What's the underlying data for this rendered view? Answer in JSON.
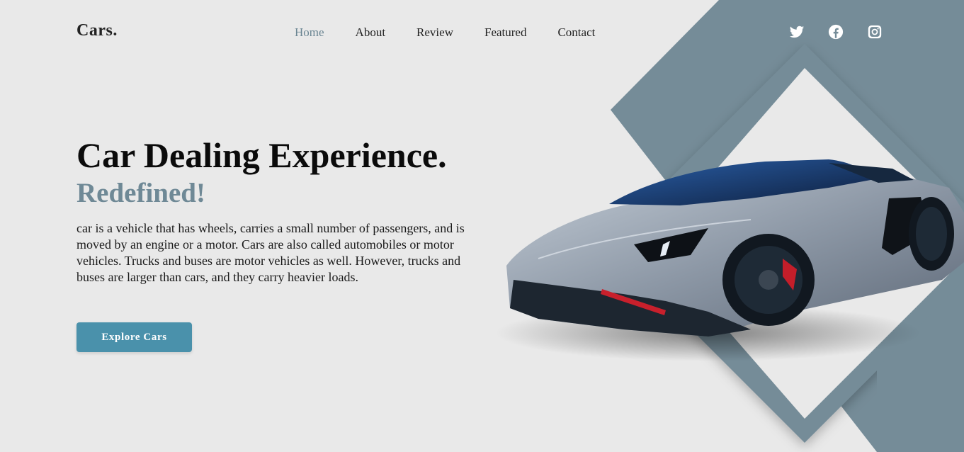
{
  "brand": {
    "logo": "Cars."
  },
  "nav": {
    "items": [
      {
        "label": "Home",
        "active": true
      },
      {
        "label": "About"
      },
      {
        "label": "Review"
      },
      {
        "label": "Featured"
      },
      {
        "label": "Contact"
      }
    ]
  },
  "social": {
    "icons": [
      "twitter-icon",
      "facebook-icon",
      "instagram-icon"
    ]
  },
  "hero": {
    "title": "Car Dealing Experience.",
    "subtitle": "Redefined!",
    "description": "car is a vehicle that has wheels, carries a small number of passengers, and is moved by an engine or a motor. Cars are also called automobiles or motor vehicles. Trucks and buses are motor vehicles as well. However, trucks and buses are larger than cars, and they carry heavier loads.",
    "cta_label": "Explore Cars"
  },
  "colors": {
    "background": "#e9e9e9",
    "accent_slate": "#748c98",
    "button": "#4a91ab"
  }
}
